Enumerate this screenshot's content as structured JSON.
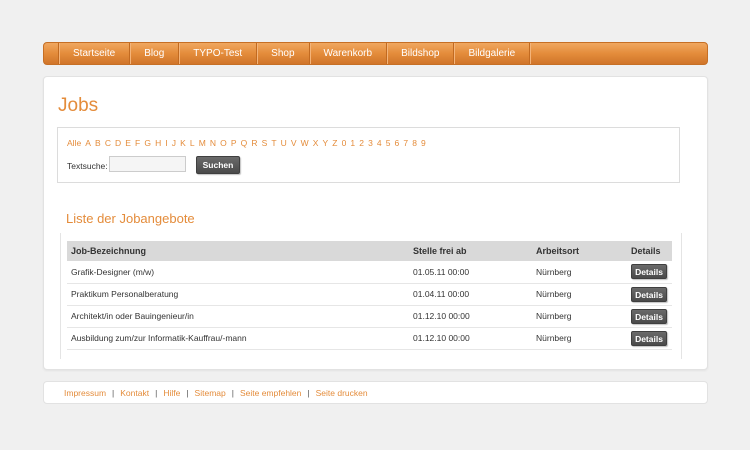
{
  "nav": {
    "items": [
      {
        "label": "Startseite"
      },
      {
        "label": "Blog"
      },
      {
        "label": "TYPO-Test"
      },
      {
        "label": "Shop"
      },
      {
        "label": "Warenkorb"
      },
      {
        "label": "Bildshop"
      },
      {
        "label": "Bildgalerie"
      }
    ]
  },
  "page": {
    "title": "Jobs"
  },
  "filter": {
    "alphabet": [
      "Alle",
      "A",
      "B",
      "C",
      "D",
      "E",
      "F",
      "G",
      "H",
      "I",
      "J",
      "K",
      "L",
      "M",
      "N",
      "O",
      "P",
      "Q",
      "R",
      "S",
      "T",
      "U",
      "V",
      "W",
      "X",
      "Y",
      "Z",
      "0",
      "1",
      "2",
      "3",
      "4",
      "5",
      "6",
      "7",
      "8",
      "9"
    ],
    "search_label": "Textsuche:",
    "search_value": "",
    "search_button": "Suchen"
  },
  "list": {
    "title": "Liste der Jobangebote",
    "columns": [
      "Job-Bezeichnung",
      "Stelle frei ab",
      "Arbeitsort",
      "Details"
    ],
    "rows": [
      {
        "title": "Grafik-Designer (m/w)",
        "date": "01.05.11 00:00",
        "location": "Nürnberg",
        "button": "Details"
      },
      {
        "title": "Praktikum Personalberatung",
        "date": "01.04.11 00:00",
        "location": "Nürnberg",
        "button": "Details"
      },
      {
        "title": "Architekt/in oder Bauingenieur/in",
        "date": "01.12.10 00:00",
        "location": "Nürnberg",
        "button": "Details"
      },
      {
        "title": "Ausbildung zum/zur Informatik-Kauffrau/-mann",
        "date": "01.12.10 00:00",
        "location": "Nürnberg",
        "button": "Details"
      }
    ]
  },
  "footer": {
    "links": [
      "Impressum",
      "Kontakt",
      "Hilfe",
      "Sitemap",
      "Seite empfehlen",
      "Seite drucken"
    ],
    "separator": "|"
  },
  "colors": {
    "accent": "#e48c3b",
    "button_dark": "#4a4a4a",
    "table_header": "#d9d9d9",
    "background": "#f0f0f0"
  }
}
